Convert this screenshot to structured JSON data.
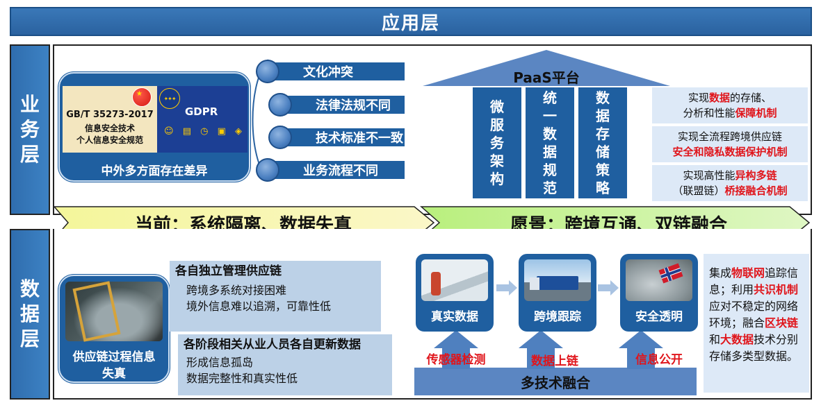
{
  "app_layer": {
    "title": "应用层"
  },
  "business_layer": {
    "label_chars": [
      "业",
      "务",
      "层"
    ],
    "diff_card": {
      "std_cn": "GB/T 35273-2017",
      "std_cn_line2": "信息安全技术",
      "std_cn_line3": "个人信息安全规范",
      "gdpr": "GDPR",
      "title": "中外多方面存在差异"
    },
    "issues": [
      "文化冲突",
      "法律法规不同",
      "技术标准不一致",
      "业务流程不同"
    ],
    "platform": {
      "title": "PaaS平台",
      "columns": [
        {
          "chars": [
            "微",
            "服",
            "务",
            "架",
            "构"
          ]
        },
        {
          "chars": [
            "统",
            "一",
            "数",
            "据",
            "规",
            "范"
          ]
        },
        {
          "chars": [
            "数",
            "据",
            "存",
            "储",
            "策",
            "略"
          ]
        }
      ]
    },
    "goals": [
      {
        "l1_a": "实现",
        "l1_red": "数据",
        "l1_b": "的存储、",
        "l2_a": "分析和性能",
        "l2_red": "保障机制"
      },
      {
        "l1_a": "实现全流程跨境供应链",
        "l2_red": "安全和隐私数据保护机制"
      },
      {
        "l1_a": "实现高性能",
        "l1_red": "异构多链",
        "l2_a": "（联盟链）",
        "l2_red": "桥接融合机制"
      }
    ]
  },
  "banner": {
    "current": "当前：系统隔离、数据失真",
    "vision": "愿景：跨境互通、双链融合"
  },
  "data_layer": {
    "label_chars": [
      "数",
      "据",
      "层"
    ],
    "supply_card": {
      "line1": "供应链过程信息",
      "line2": "失真"
    },
    "problem1": {
      "heading": "各自独立管理供应链",
      "lines": [
        "跨境多系统对接困难",
        "境外信息难以追溯，可靠性低"
      ]
    },
    "problem2": {
      "heading": "各阶段相关从业人员各自更新数据",
      "lines": [
        "形成信息孤岛",
        "数据完整性和真实性低"
      ]
    },
    "nodes": [
      "真实数据",
      "跨境跟踪",
      "安全透明"
    ],
    "tech_labels": [
      "传感器检测",
      "数据上链",
      "信息公开"
    ],
    "fusion": "多技术融合",
    "summary": {
      "p1": "集成",
      "r1": "物联网",
      "p2": "追踪信息；利用",
      "r2": "共识机制",
      "p3": "应对不稳定的网络环境；融合",
      "r3": "区块链",
      "p4": "和",
      "r4": "大数据",
      "p5": "技术分别存储多类型数据。"
    }
  }
}
